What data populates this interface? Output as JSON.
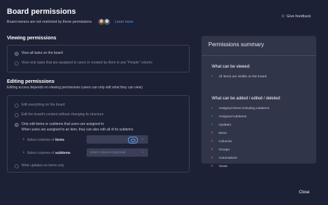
{
  "header": {
    "title": "Board permissions",
    "subtitle": "Board owners are not restricted by these permissions",
    "learn_more": "Learn more",
    "give_feedback": "Give feedback"
  },
  "viewing": {
    "heading": "Viewing permissions",
    "options": [
      "View all tasks on the board",
      "View only tasks that are assigned to users or created by them in any \"People\" column"
    ],
    "selected_index": 0
  },
  "editing": {
    "heading": "Editing permissions",
    "description": "Editing access depends on viewing permissions (users can only edit what they can view)",
    "options": [
      "Edit everything on the board",
      "Edit the board's content without changing its structure",
      "Only edit items or subitems that users are assigned to"
    ],
    "selected_index": 2,
    "assigned_note": "When users are assigned to an item, they can also edit all of its subitems",
    "select_items_prefix": "Select columns of",
    "select_items_word": "items",
    "select_subitems_prefix": "Select columns of",
    "select_subitems_word": "subitems",
    "subitems_placeholder": "Select columns (optional)",
    "write_updates": "Write updates on items only"
  },
  "summary": {
    "title": "Permissions summary",
    "viewed_heading": "What can be viewed:",
    "viewed_items": [
      {
        "label": "All items are visible on the board",
        "allowed": true
      }
    ],
    "edit_heading": "What can be added / edited / deleted:",
    "edit_items": [
      {
        "label": "Assigned items including subitems",
        "allowed": true
      },
      {
        "label": "Assigned subitems",
        "allowed": true
      },
      {
        "label": "Updates",
        "allowed": true
      },
      {
        "label": "Items",
        "allowed": false
      },
      {
        "label": "Columns",
        "allowed": false
      },
      {
        "label": "Groups",
        "allowed": false
      },
      {
        "label": "Automations",
        "allowed": false
      },
      {
        "label": "Views",
        "allowed": false
      }
    ]
  },
  "footer": {
    "close": "Close"
  },
  "colors": {
    "background": "#1d2135",
    "panel": "#30354a",
    "accent": "#579bfc",
    "allowed": "#00c875",
    "denied": "#e2445c"
  },
  "icons": {
    "feedback": "feedback-icon",
    "check": "check-icon",
    "cross": "cross-icon",
    "subitem": "subitem-arrow-icon",
    "dropdown": "chevron-down-icon"
  }
}
